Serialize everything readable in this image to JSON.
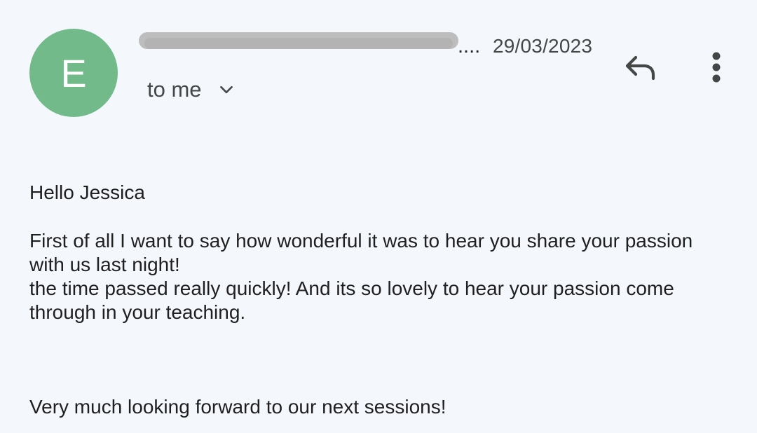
{
  "avatar": {
    "initial": "E",
    "color": "#72ba8a"
  },
  "header": {
    "sender_ellipsis": "....",
    "date": "29/03/2023",
    "recipient_label": "to me"
  },
  "icons": {
    "expand": "chevron-down-icon",
    "reply": "reply-icon",
    "more": "more-vert-icon"
  },
  "message": {
    "greeting": "Hello Jessica",
    "lines": [
      "First of all I want to say how wonderful it was to hear you share your passion",
      "with us last night!",
      "the time passed really quickly!  And its so lovely to hear your passion come",
      "through in your teaching."
    ],
    "closing": "Very much looking forward to our next sessions!"
  }
}
